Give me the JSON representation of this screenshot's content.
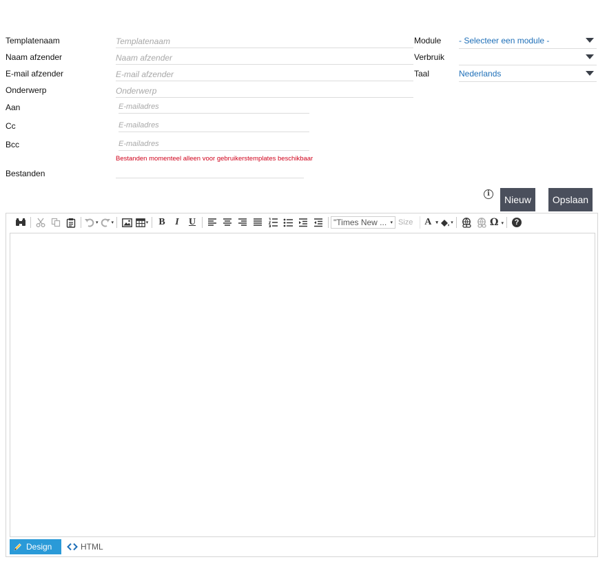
{
  "form": {
    "template_name_label": "Templatenaam",
    "template_name_placeholder": "Templatenaam",
    "sender_name_label": "Naam afzender",
    "sender_name_placeholder": "Naam afzender",
    "sender_email_label": "E-mail afzender",
    "sender_email_placeholder": "E-mail afzender",
    "subject_label": "Onderwerp",
    "subject_placeholder": "Onderwerp",
    "to_label": "Aan",
    "to_placeholder": "E-mailadres",
    "cc_label": "Cc",
    "cc_placeholder": "E-mailadres",
    "bcc_label": "Bcc",
    "bcc_placeholder": "E-mailadres",
    "files_warning": "Bestanden momenteel alleen voor gebruikerstemplates beschikbaar",
    "files_label": "Bestanden"
  },
  "selects": {
    "module_label": "Module",
    "module_value": "- Selecteer een module -",
    "usage_label": "Verbruik",
    "usage_value": "",
    "language_label": "Taal",
    "language_value": "Nederlands"
  },
  "actions": {
    "info_glyph": "i",
    "new_label": "Nieuw",
    "save_label": "Opslaan"
  },
  "editor": {
    "font_name": "\"Times New ...",
    "size_placeholder": "Size",
    "bold_glyph": "B",
    "italic_glyph": "I",
    "underline_glyph": "U",
    "forecolor_glyph": "A",
    "symbol_glyph": "Ω",
    "help_glyph": "?",
    "mode_design_label": "Design",
    "mode_html_label": "HTML"
  },
  "colors": {
    "button_bg": "#4a4f5c",
    "link_blue": "#1e6fb8",
    "warning_red": "#d0021b",
    "design_tab_bg": "#2a9ad8"
  },
  "icons": [
    "find-icon",
    "cut-icon",
    "copy-icon",
    "paste-icon",
    "undo-icon",
    "redo-icon",
    "image-icon",
    "table-icon",
    "align-left-icon",
    "align-center-icon",
    "align-right-icon",
    "align-justify-icon",
    "ordered-list-icon",
    "unordered-list-icon",
    "indent-icon",
    "outdent-icon",
    "backcolor-icon",
    "link-icon",
    "unlink-icon",
    "pencil-icon",
    "code-icon",
    "info-icon"
  ]
}
